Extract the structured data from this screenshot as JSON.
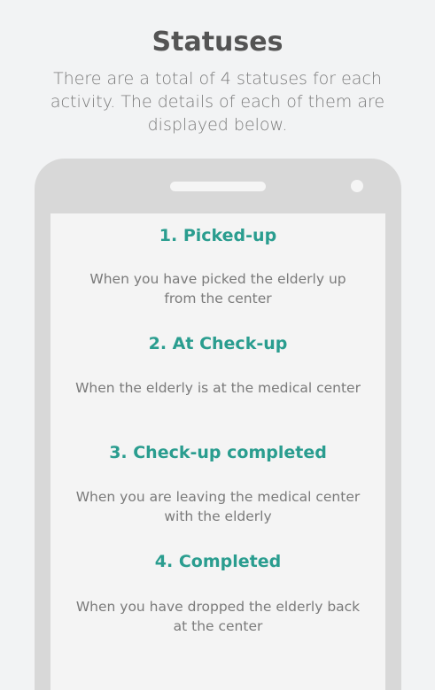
{
  "header": {
    "title": "Statuses",
    "subtitle": "There are a total of 4 statuses for each activity. The details of each of them are displayed below."
  },
  "statuses": [
    {
      "title": "1. Picked-up",
      "description": "When you have picked the elderly up from the center"
    },
    {
      "title": "2. At Check-up",
      "description": "When the elderly is at the medical center"
    },
    {
      "title": "3. Check-up completed",
      "description": "When you are leaving the medical center with the elderly"
    },
    {
      "title": "4. Completed",
      "description": "When you have dropped the elderly back at the center"
    }
  ],
  "colors": {
    "background": "#f2f3f4",
    "phone_frame": "#d8d8d8",
    "status_title": "#2a9d8f",
    "body_text": "#7a7a7a",
    "heading_text": "#545454"
  }
}
